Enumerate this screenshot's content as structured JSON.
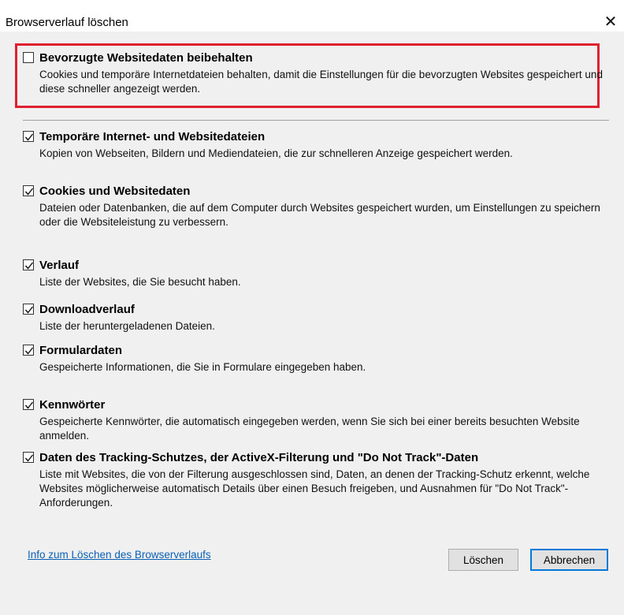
{
  "window": {
    "title": "Browserverlauf löschen",
    "close_glyph": "✕"
  },
  "options": [
    {
      "key": "preserve",
      "label": "Bevorzugte Websitedaten beibehalten",
      "description": "Cookies und temporäre Internetdateien behalten, damit die Einstellungen für die bevorzugten Websites gespeichert und diese schneller angezeigt werden.",
      "checked": false
    },
    {
      "key": "temp",
      "label": "Temporäre Internet- und Websitedateien",
      "description": "Kopien von Webseiten, Bildern und Mediendateien, die zur schnelleren Anzeige gespeichert werden.",
      "checked": true
    },
    {
      "key": "cookies",
      "label": "Cookies und Websitedaten",
      "description": "Dateien oder Datenbanken, die auf dem Computer durch Websites gespeichert wurden, um Einstellungen zu speichern oder die Websiteleistung zu verbessern.",
      "checked": true
    },
    {
      "key": "history",
      "label": "Verlauf",
      "description": "Liste der Websites, die Sie besucht haben.",
      "checked": true
    },
    {
      "key": "downloads",
      "label": "Downloadverlauf",
      "description": "Liste der heruntergeladenen Dateien.",
      "checked": true
    },
    {
      "key": "formdata",
      "label": "Formulardaten",
      "description": "Gespeicherte Informationen, die Sie in Formulare eingegeben haben.",
      "checked": true
    },
    {
      "key": "passwords",
      "label": "Kennwörter",
      "description": "Gespeicherte Kennwörter, die automatisch eingegeben werden, wenn Sie sich bei einer bereits besuchten Website anmelden.",
      "checked": true
    },
    {
      "key": "tracking",
      "label": "Daten des Tracking-Schutzes, der ActiveX-Filterung und \"Do Not Track\"-Daten",
      "description": "Liste mit Websites, die von der Filterung ausgeschlossen sind, Daten, an denen der Tracking-Schutz erkennt, welche Websites möglicherweise automatisch Details über einen Besuch freigeben, und Ausnahmen für \"Do Not Track\"-Anforderungen.",
      "checked": true
    }
  ],
  "footer": {
    "info_link": "Info zum Löschen des Browserverlaufs",
    "delete_label": "Löschen",
    "cancel_label": "Abbrechen"
  },
  "colors": {
    "highlight": "#e0202f",
    "link": "#0a5fb4",
    "default_button_border": "#0078d7"
  }
}
